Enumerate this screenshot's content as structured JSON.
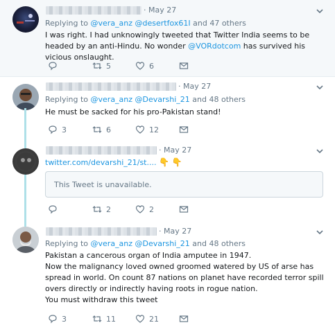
{
  "tweets": [
    {
      "date": "May 27",
      "replying_to_label": "Replying to ",
      "mentions": "@vera_anz @desertfox61I",
      "others": " and 47 others",
      "text_parts": [
        "I was right. I had unknowingly tweeted that Twitter India seems to be headed by an anti-Hindu. No wonder ",
        "@VORdotcom",
        " has survived his vicious onslaught."
      ],
      "reply_count": "",
      "retweet_count": "5",
      "like_count": "6"
    },
    {
      "date": "May 27",
      "replying_to_label": "Replying to ",
      "mentions": "@vera_anz @Devarshi_21",
      "others": " and 48 others",
      "text": "He must be sacked for his pro-Pakistan stand!",
      "reply_count": "3",
      "retweet_count": "6",
      "like_count": "12"
    },
    {
      "date": "May 27",
      "link": "twitter.com/devarshi_21/st....",
      "emoji": "👇 👇",
      "quote_unavailable": "This Tweet is unavailable.",
      "reply_count": "",
      "retweet_count": "2",
      "like_count": "2"
    },
    {
      "date": "May 27",
      "replying_to_label": "Replying to ",
      "mentions": "@vera_anz @Devarshi_21",
      "others": " and 48 others",
      "lines": [
        "Pakistan a cancerous organ of India amputee in 1947.",
        "Now the malignancy loved owned groomed watered by US of arse has spread in world. On count 87 nations on planet have recorded terror spill overs directly or indirectly having roots in rogue nation.",
        "You must withdraw this tweet"
      ],
      "reply_count": "3",
      "retweet_count": "11",
      "like_count": "21"
    }
  ],
  "colors": {
    "link": "#1b95e0",
    "muted": "#657786",
    "thread_line": "#aee0e8",
    "highlight_bg": "#f5f8fa"
  },
  "icons": [
    "reply-icon",
    "retweet-icon",
    "like-icon",
    "dm-icon",
    "chevron-down-icon"
  ]
}
